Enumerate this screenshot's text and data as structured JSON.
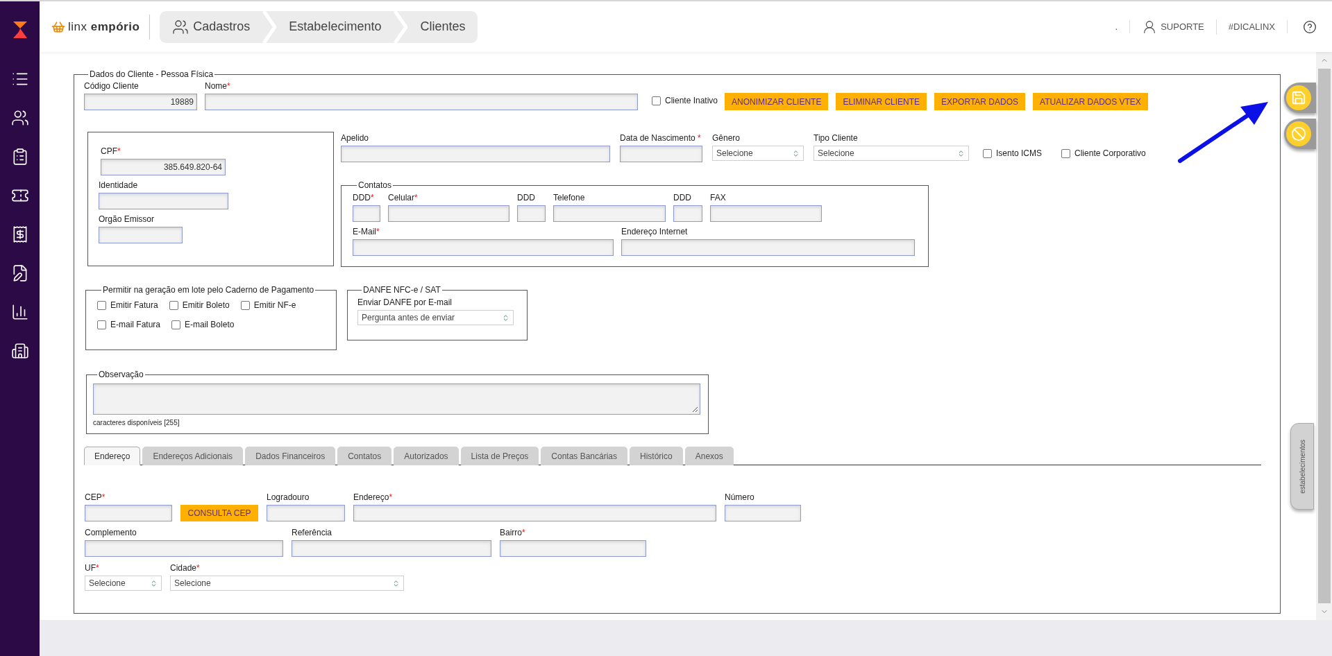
{
  "header": {
    "brand": "linx **empório**",
    "breadcrumbs": [
      "Cadastros",
      "Estabelecimento",
      "Clientes"
    ],
    "links": [
      {
        "kind": "text",
        "label": "."
      },
      {
        "kind": "user",
        "label": "SUPORTE"
      },
      {
        "kind": "text",
        "label": "#DICALINX"
      },
      {
        "kind": "help"
      }
    ]
  },
  "form": {
    "legend": "Dados do Cliente - Pessoa Física",
    "top_fields": [
      {
        "kind": "input",
        "label": "Código Cliente",
        "value": "19889"
      },
      {
        "kind": "input",
        "label": "Nome",
        "mark": "*"
      }
    ],
    "inactive": {
      "label": "Cliente Inativo",
      "checked": false
    },
    "actions": [
      "ANONIMIZAR CLIENTE",
      "ELIMINAR CLIENTE",
      "EXPORTAR DADOS",
      "ATUALIZAR DADOS VTEX"
    ],
    "document_fields": [
      {
        "kind": "input",
        "label": "CPF",
        "mark": "*",
        "value": "385.649.820-64"
      },
      {
        "kind": "input",
        "label": "Identidade"
      },
      {
        "kind": "input",
        "label": "Orgão Emissor"
      }
    ],
    "personal_fields": [
      {
        "kind": "input",
        "label": "Apelido"
      },
      {
        "kind": "input",
        "label": "Data de Nascimento",
        "mark": " *"
      },
      {
        "kind": "select",
        "label": "Gênero",
        "value": "Selecione"
      },
      {
        "kind": "select",
        "label": "Tipo Cliente",
        "value": "Selecione"
      }
    ],
    "flags": [
      {
        "label": "Isento ICMS",
        "checked": false
      },
      {
        "label": "Cliente Corporativo",
        "checked": false
      }
    ],
    "contacts": {
      "legend": "Contatos",
      "phones": [
        {
          "kind": "input",
          "label": "DDD",
          "mark": "*"
        },
        {
          "kind": "input",
          "label": "Celular",
          "mark": "*"
        },
        {
          "kind": "input",
          "label": "DDD"
        },
        {
          "kind": "input",
          "label": "Telefone"
        },
        {
          "kind": "input",
          "label": "DDD"
        },
        {
          "kind": "input",
          "label": "FAX"
        }
      ],
      "online": [
        {
          "kind": "input",
          "label": "E-Mail",
          "mark": "*"
        },
        {
          "kind": "input",
          "label": "Endereço Internet"
        }
      ]
    },
    "batch": {
      "legend": "Permitir na geração em lote pelo Caderno de Pagamento",
      "rows": [
        [
          {
            "label": "Emitir Fatura",
            "checked": false
          },
          {
            "label": "Emitir Boleto",
            "checked": false
          },
          {
            "label": "Emitir NF-e",
            "checked": false
          }
        ],
        [
          {
            "label": "E-mail Fatura",
            "checked": false
          },
          {
            "label": "E-mail Boleto",
            "checked": false
          }
        ]
      ]
    },
    "danfe": {
      "legend": "DANFE NFC-e / SAT",
      "field": {
        "kind": "select",
        "label": "Enviar DANFE por E-mail",
        "value": "Pergunta antes de enviar"
      }
    },
    "notes": {
      "legend": "Observação",
      "counter": "caracteres disponíveis [255]"
    },
    "tabs": [
      {
        "label": "Endereço",
        "selected": true
      },
      {
        "label": "Endereços Adicionais",
        "selected": false
      },
      {
        "label": "Dados Financeiros",
        "selected": false
      },
      {
        "label": "Contatos",
        "selected": false
      },
      {
        "label": "Autorizados",
        "selected": false
      },
      {
        "label": "Lista de Preços",
        "selected": false
      },
      {
        "label": "Contas Bancárias",
        "selected": false
      },
      {
        "label": "Histórico",
        "selected": false
      },
      {
        "label": "Anexos",
        "selected": false
      }
    ],
    "address_rows": [
      [
        {
          "kind": "input",
          "label": "CEP",
          "mark": "*"
        },
        {
          "kind": "button",
          "label": "CONSULTA CEP"
        },
        {
          "kind": "input",
          "label": "Logradouro"
        },
        {
          "kind": "input",
          "label": "Endereço",
          "mark": "*"
        },
        {
          "kind": "input",
          "label": "Número"
        }
      ],
      [
        {
          "kind": "input",
          "label": "Complemento"
        },
        {
          "kind": "input",
          "label": "Referência"
        },
        {
          "kind": "input",
          "label": "Bairro",
          "mark": "*"
        }
      ],
      [
        {
          "kind": "select",
          "label": "UF",
          "mark": "*",
          "value": "Selecione"
        },
        {
          "kind": "select",
          "label": "Cidade",
          "mark": "*",
          "value": "Selecione"
        }
      ]
    ]
  },
  "side_actions": [
    {
      "kind": "save"
    },
    {
      "kind": "cancel"
    }
  ],
  "side_tab": "estabelecimentos"
}
